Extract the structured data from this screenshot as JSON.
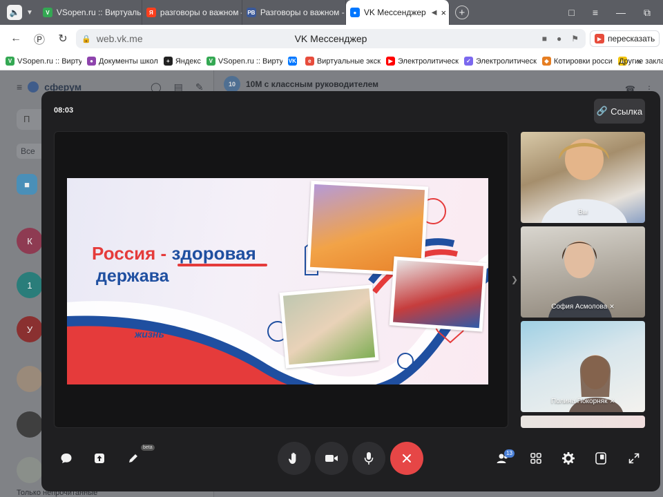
{
  "browser": {
    "tabs": [
      {
        "label": "VSopen.ru :: Виртуальная",
        "favicon": "vsopen-icon",
        "color": "#34a853"
      },
      {
        "label": "разговоры о важном — Я",
        "favicon": "yandex-icon",
        "color": "#fc3f1d"
      },
      {
        "label": "Разговоры о важном - Ро",
        "favicon": "rv-icon",
        "color": "#3b5998"
      },
      {
        "label": "VK Мессенджер",
        "favicon": "vk-messenger-icon",
        "color": "#0077ff",
        "active": true
      }
    ],
    "address": {
      "url": "web.vk.me",
      "title": "VK Мессенджер",
      "retell_label": "пересказать"
    },
    "bookmarks": [
      {
        "label": "VSopen.ru :: Вирту",
        "color": "#34a853"
      },
      {
        "label": "Документы школ",
        "color": "#8e44ad"
      },
      {
        "label": "Яндекс",
        "color": "#222222"
      },
      {
        "label": "VSopen.ru :: Вирту",
        "color": "#34a853"
      },
      {
        "label": "",
        "color": "#0077ff"
      },
      {
        "label": "Виртуальные экск",
        "color": "#e74c3c"
      },
      {
        "label": "Электролитическ",
        "color": "#ff0000"
      },
      {
        "label": "Электролитическ",
        "color": "#7b68ee"
      },
      {
        "label": "Котировки росси",
        "color": "#e67e22"
      },
      {
        "label": "",
        "color": "#f1c40f"
      }
    ],
    "bookmarks_more": "»",
    "bookmarks_other": "Другие заклад"
  },
  "messenger": {
    "brand": "сферум",
    "search_placeholder": "П",
    "filter_label": "Все",
    "chat_title": "10М с классным руководителем",
    "chat_avatar": "10",
    "avatars": [
      {
        "letter": "К",
        "color": "#8e3b52"
      },
      {
        "letter": "1",
        "color": "#2a7d7a"
      },
      {
        "letter": "У",
        "color": "#8a3030"
      }
    ],
    "bottom_label": "Только непрочитанные"
  },
  "call": {
    "timer": "08:03",
    "link_label": "Ссылка",
    "slide": {
      "title_part1": "Россия",
      "title_dash": "-",
      "title_part2": "здоровая",
      "title_line2": "держава",
      "tagline": "жизнь"
    },
    "participants": [
      {
        "name": "Вы",
        "muted": false,
        "bg": "#c9b79a"
      },
      {
        "name": "София Асмолова",
        "muted": true,
        "bg": "#b9b4ac"
      },
      {
        "name": "Полина Покорняк",
        "muted": true,
        "bg": "#9fbfcf"
      }
    ],
    "participants_count": "13",
    "beta_label": "beta",
    "colors": {
      "accent": "#4a7fd6",
      "hangup": "#e64646",
      "flag_red": "#e53b3b",
      "flag_blue": "#1f4fa0"
    }
  }
}
